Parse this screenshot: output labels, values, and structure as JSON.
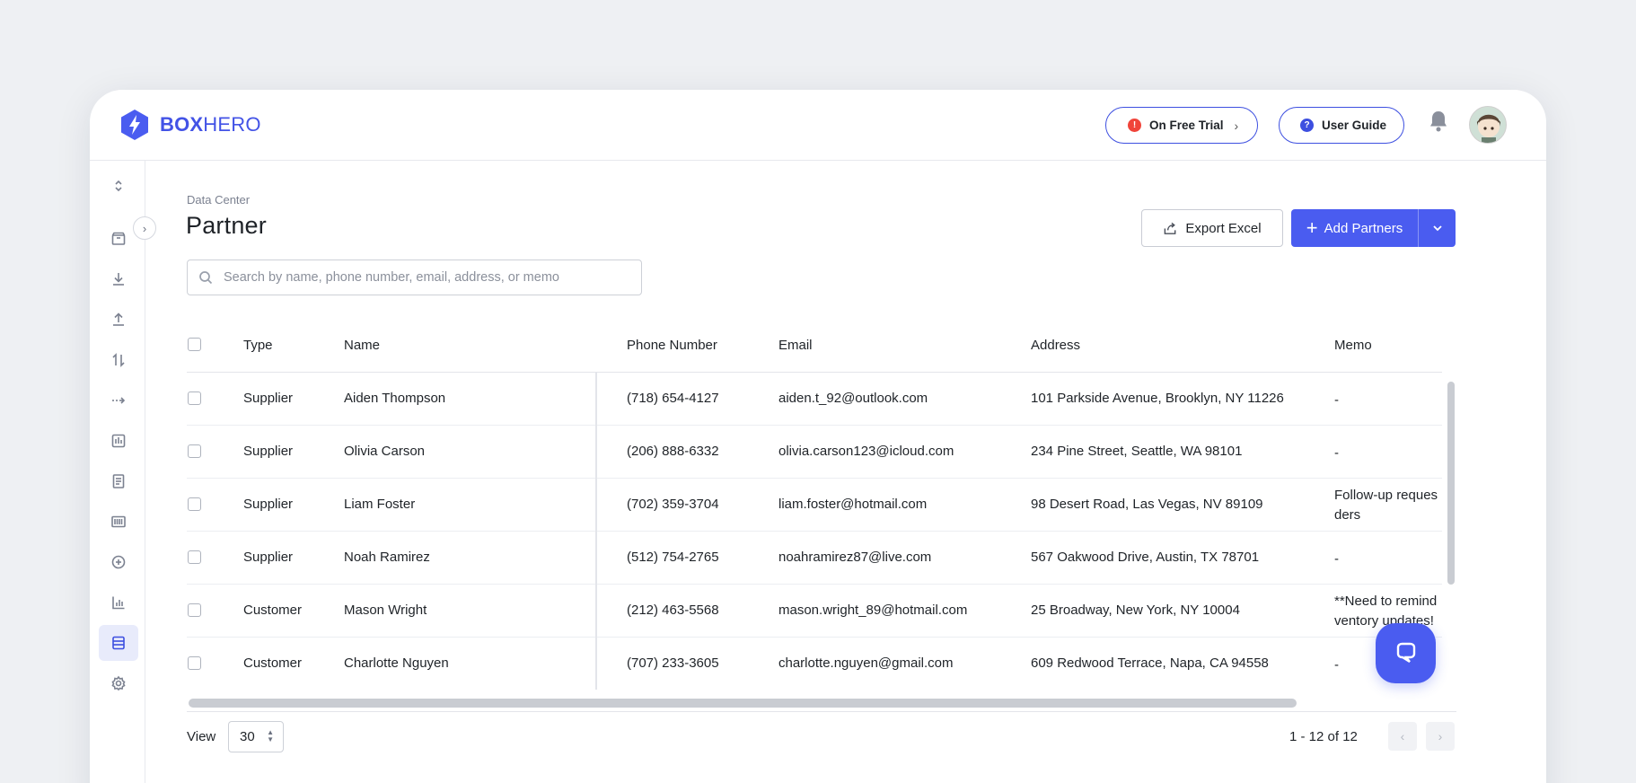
{
  "brand": {
    "bold": "BOX",
    "light": "HERO",
    "color": "#4353e6"
  },
  "header": {
    "trial_label": "On Free Trial",
    "trial_icon": "alert-icon",
    "guide_label": "User Guide",
    "guide_icon": "help-icon",
    "notifications_icon": "bell-icon"
  },
  "sidebar": {
    "items": [
      {
        "name": "sort-icon"
      },
      {
        "name": "box-icon"
      },
      {
        "name": "stock-in-icon"
      },
      {
        "name": "stock-out-icon"
      },
      {
        "name": "adjust-icon"
      },
      {
        "name": "move-icon"
      },
      {
        "name": "report-icon"
      },
      {
        "name": "document-icon"
      },
      {
        "name": "barcode-icon"
      },
      {
        "name": "add-circle-icon"
      },
      {
        "name": "chart-icon"
      },
      {
        "name": "data-center-icon",
        "active": true
      },
      {
        "name": "settings-icon"
      }
    ]
  },
  "page": {
    "breadcrumb": "Data Center",
    "title": "Partner",
    "export_label": "Export Excel",
    "add_label": "Add Partners",
    "search_placeholder": "Search by name, phone number, email, address, or memo"
  },
  "table": {
    "columns": [
      "Type",
      "Name",
      "Phone Number",
      "Email",
      "Address",
      "Memo"
    ],
    "rows": [
      {
        "type": "Supplier",
        "name": "Aiden Thompson",
        "phone": "(718) 654-4127",
        "email": "aiden.t_92@outlook.com",
        "address": "101 Parkside Avenue, Brooklyn, NY 11226",
        "memo": "-"
      },
      {
        "type": "Supplier",
        "name": "Olivia Carson",
        "phone": "(206) 888-6332",
        "email": "olivia.carson123@icloud.com",
        "address": "234 Pine Street, Seattle, WA 98101",
        "memo": "-"
      },
      {
        "type": "Supplier",
        "name": "Liam Foster",
        "phone": "(702) 359-3704",
        "email": "liam.foster@hotmail.com",
        "address": "98 Desert Road, Las Vegas, NV 89109",
        "memo": "Follow-up reques ders"
      },
      {
        "type": "Supplier",
        "name": "Noah Ramirez",
        "phone": "(512) 754-2765",
        "email": "noahramirez87@live.com",
        "address": "567 Oakwood Drive, Austin, TX 78701",
        "memo": "-"
      },
      {
        "type": "Customer",
        "name": "Mason Wright",
        "phone": "(212) 463-5568",
        "email": "mason.wright_89@hotmail.com",
        "address": "25 Broadway, New York, NY 10004",
        "memo": "**Need to remind ventory updates!"
      },
      {
        "type": "Customer",
        "name": "Charlotte Nguyen",
        "phone": "(707) 233-3605",
        "email": "charlotte.nguyen@gmail.com",
        "address": "609 Redwood Terrace, Napa, CA 94558",
        "memo": "-"
      }
    ]
  },
  "footer": {
    "view_label": "View",
    "view_value": "30",
    "page_count": "1 - 12 of 12",
    "prev_icon": "chevron-left-icon",
    "next_icon": "chevron-right-icon",
    "chat_icon": "chat-icon"
  }
}
